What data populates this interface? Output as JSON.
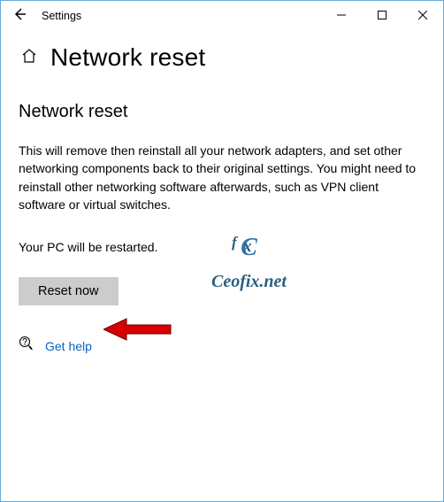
{
  "window": {
    "title": "Settings"
  },
  "header": {
    "page_title": "Network reset"
  },
  "main": {
    "section_heading": "Network reset",
    "description": "This will remove then reinstall all your network adapters, and set other networking components back to their original settings. You might need to reinstall other networking software afterwards, such as VPN client software or virtual switches.",
    "restart_note": "Your PC will be restarted.",
    "reset_button_label": "Reset now",
    "help_link_label": "Get help"
  },
  "watermark": {
    "line1_letter": "C",
    "line1_suffix1": "f",
    "line1_suffix2": "x",
    "line2": "Ceofix.net"
  }
}
